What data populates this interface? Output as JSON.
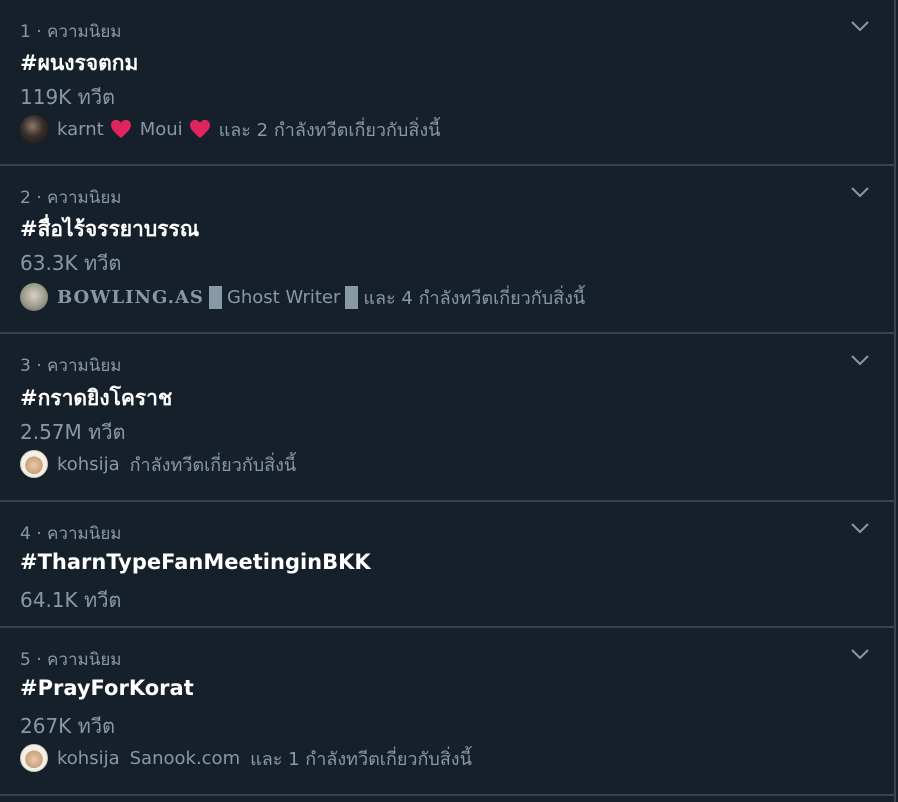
{
  "trends": [
    {
      "rank_label": "1 · ความนิยม",
      "hashtag": "#ผนงรจตกม",
      "tweet_count": "119K ทวีต",
      "tweeters": {
        "users": [
          "karnt",
          "Moui"
        ],
        "suffix": "และ 2 กำลังทวีตเกี่ยวกับสิ่งนี้"
      }
    },
    {
      "rank_label": "2 · ความนิยม",
      "hashtag": "#สื่อไร้จรรยาบรรณ",
      "tweet_count": "63.3K ทวีต",
      "tweeters": {
        "users": [
          "BOWLING.AS",
          "Ghost Writer"
        ],
        "suffix": "และ 4 กำลังทวีตเกี่ยวกับสิ่งนี้"
      }
    },
    {
      "rank_label": "3 · ความนิยม",
      "hashtag": "#กราดยิงโคราช",
      "tweet_count": "2.57M ทวีต",
      "tweeters": {
        "users": [
          "kohsija"
        ],
        "suffix": "กำลังทวีตเกี่ยวกับสิ่งนี้"
      }
    },
    {
      "rank_label": "4 · ความนิยม",
      "hashtag": "#TharnTypeFanMeetinginBKK",
      "tweet_count": "64.1K ทวีต"
    },
    {
      "rank_label": "5 · ความนิยม",
      "hashtag": "#PrayForKorat",
      "tweet_count": "267K ทวีต",
      "tweeters": {
        "users": [
          "kohsija",
          "Sanook.com"
        ],
        "suffix": "และ 1 กำลังทวีตเกี่ยวกับสิ่งนี้"
      }
    }
  ],
  "icons": {
    "more": "chevron-down-icon",
    "heart": "red-heart-icon"
  },
  "colors": {
    "background": "#15202b",
    "divider": "#38444d",
    "primary_text": "#ffffff",
    "secondary_text": "#8899a6",
    "heart": "#e0245e"
  }
}
